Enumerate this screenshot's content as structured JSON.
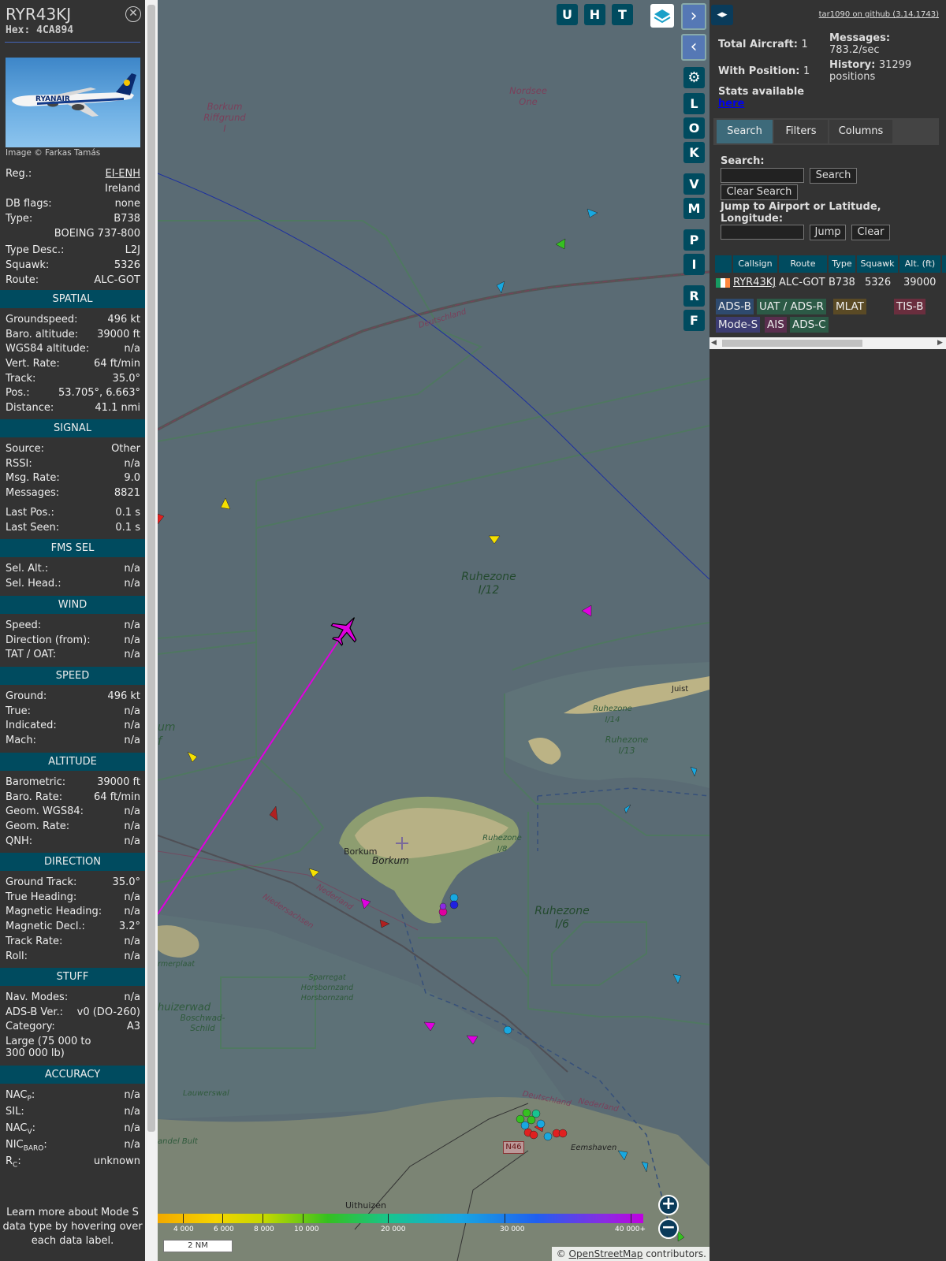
{
  "selected": {
    "callsign": "RYR43KJ",
    "hex": "Hex: 4CA894",
    "photo_credit": "Image © Farkas Tamás",
    "photo_livery_text": "RYANAIR"
  },
  "info_rows": [
    {
      "label": "Reg.:",
      "value": "EI-ENH"
    },
    {
      "label": "",
      "value": "Ireland"
    },
    {
      "label": "DB flags:",
      "value": "none"
    },
    {
      "label": "Type:",
      "value": "B738"
    },
    {
      "label": "",
      "value": "BOEING 737-800"
    },
    {
      "label": "Type Desc.:",
      "value": "L2J"
    },
    {
      "label": "Squawk:",
      "value": "5326"
    },
    {
      "label": "Route:",
      "value": "ALC-GOT"
    }
  ],
  "sections": [
    {
      "title": "SPATIAL",
      "rows": [
        [
          "Groundspeed:",
          "496 kt"
        ],
        [
          "Baro. altitude:",
          "39000 ft"
        ],
        [
          "WGS84 altitude:",
          "n/a"
        ],
        [
          "Vert. Rate:",
          "64 ft/min"
        ],
        [
          "Track:",
          "35.0°"
        ],
        [
          "Pos.:",
          "53.705°, 6.663°"
        ],
        [
          "Distance:",
          "41.1 nmi"
        ]
      ]
    },
    {
      "title": "SIGNAL",
      "rows": [
        [
          "Source:",
          "Other"
        ],
        [
          "RSSI:",
          "n/a"
        ],
        [
          "Msg. Rate:",
          "9.0"
        ],
        [
          "Messages:",
          "8821"
        ],
        [
          "Last Pos.:",
          "0.1 s"
        ],
        [
          "Last Seen:",
          "0.1 s"
        ]
      ]
    },
    {
      "title": "FMS SEL",
      "rows": [
        [
          "Sel. Alt.:",
          "n/a"
        ],
        [
          "Sel. Head.:",
          "n/a"
        ]
      ]
    },
    {
      "title": "WIND",
      "rows": [
        [
          "Speed:",
          "n/a"
        ],
        [
          "Direction (from):",
          "n/a"
        ],
        [
          "TAT / OAT:",
          "n/a"
        ]
      ]
    },
    {
      "title": "SPEED",
      "rows": [
        [
          "Ground:",
          "496 kt"
        ],
        [
          "True:",
          "n/a"
        ],
        [
          "Indicated:",
          "n/a"
        ],
        [
          "Mach:",
          "n/a"
        ]
      ]
    },
    {
      "title": "ALTITUDE",
      "rows": [
        [
          "Barometric:",
          "39000 ft"
        ],
        [
          "Baro. Rate:",
          "64 ft/min"
        ],
        [
          "Geom. WGS84:",
          "n/a"
        ],
        [
          "Geom. Rate:",
          "n/a"
        ],
        [
          "QNH:",
          "n/a"
        ]
      ]
    },
    {
      "title": "DIRECTION",
      "rows": [
        [
          "Ground Track:",
          "35.0°"
        ],
        [
          "True Heading:",
          "n/a"
        ],
        [
          "Magnetic Heading:",
          "n/a"
        ],
        [
          "Magnetic Decl.:",
          "3.2°"
        ],
        [
          "Track Rate:",
          "n/a"
        ],
        [
          "Roll:",
          "n/a"
        ]
      ]
    },
    {
      "title": "STUFF",
      "rows": [
        [
          "Nav. Modes:",
          "n/a"
        ],
        [
          "ADS-B Ver.:",
          "v0 (DO-260)"
        ],
        [
          "Category:",
          "A3"
        ]
      ]
    },
    {
      "title": "ACCURACY",
      "rows": [
        [
          "NAC",
          "n/a"
        ],
        [
          "SIL:",
          "n/a"
        ],
        [
          "NAC",
          "n/a"
        ],
        [
          "NIC",
          "n/a"
        ],
        [
          "R",
          "unknown"
        ]
      ]
    }
  ],
  "category_desc": "Large (75 000 to 300 000 lb)",
  "accuracy_subs": [
    "P",
    "V",
    "BARO",
    "C"
  ],
  "footer_help": "Learn more about Mode S data type by hovering over each data label.",
  "map": {
    "buttons": [
      "U",
      "H",
      "T",
      "L",
      "O",
      "K",
      "V",
      "M",
      "P",
      "I",
      "R",
      "F"
    ],
    "labels": {
      "borkum_riffgrund": "Borkum Riffgrund I",
      "nordsee_one": "Nordsee One",
      "deutschland": "Deutschland",
      "ruhezone_i12": "Ruhezone I/12",
      "ruhezone_i14": "Ruhezone I/14",
      "ruhezone_i13": "Ruhezone I/13",
      "ruhezone_i8": "Ruhezone I/8",
      "ruhezone_i6": "Ruhezone I/6",
      "juist": "Juist",
      "borkum_town": "Borkum",
      "borkum_island": "Borkum",
      "niedersachsen": "Niedersachsen",
      "nederland": "Nederland",
      "sparregat": "Sparregat Horsbornzand Horsbornzand",
      "boschwad": "Boschwad-Schild",
      "huizerwad": "huizerwad",
      "lauwerswal": "Lauwerswal",
      "rmerplaat": "rmerplaat",
      "andel_bult": "andel Bult",
      "deutschland2": "Deutschland",
      "nederland2": "Nederland",
      "n46": "N46",
      "eemshaven": "Eemshaven",
      "uithuizen": "Uithuizen",
      "um": "um",
      "f": "f"
    },
    "colorbar_labels": [
      "4 000",
      "6 000",
      "8 000",
      "10 000",
      "20 000",
      "30 000",
      "40 000+"
    ],
    "scale": "2 NM",
    "attribution_prefix": "© ",
    "attribution_link": "OpenStreetMap",
    "attribution_suffix": " contributors."
  },
  "right": {
    "github_link": "tar1090 on github (3.14.1743)",
    "total_aircraft_label": "Total Aircraft:",
    "total_aircraft": "1",
    "with_position_label": "With Position:",
    "with_position": "1",
    "messages_label": "Messages:",
    "messages_rate": "783.2/sec",
    "history_label": "History:",
    "history_value": "31299",
    "history_unit": "positions",
    "stats_label": "Stats available",
    "stats_link": "here",
    "tabs": [
      "Search",
      "Filters",
      "Columns"
    ],
    "search_label": "Search:",
    "search_button": "Search",
    "clear_search_button": "Clear Search",
    "jump_label": "Jump to Airport or Latitude, Longitude:",
    "jump_button": "Jump",
    "clear_button": "Clear",
    "table_headers": [
      "Callsign",
      "Route",
      "Type",
      "Squawk",
      "Alt. (ft)"
    ],
    "table_row": {
      "callsign": "RYR43KJ",
      "route": "ALC-GOT",
      "type": "B738",
      "squawk": "5326",
      "alt": "39000"
    },
    "source_tags": [
      {
        "label": "ADS-B",
        "color": "#2e4a6e"
      },
      {
        "label": "UAT / ADS-R",
        "color": "#2c5a46"
      },
      {
        "label": "MLAT",
        "color": "#5a4a25"
      },
      {
        "label": "TIS-B",
        "color": "#6a2e3e"
      },
      {
        "label": "Mode-S",
        "color": "#3c3c72"
      },
      {
        "label": "AIS",
        "color": "#5a2e4e"
      },
      {
        "label": "ADS-C",
        "color": "#2c5a46"
      }
    ]
  }
}
